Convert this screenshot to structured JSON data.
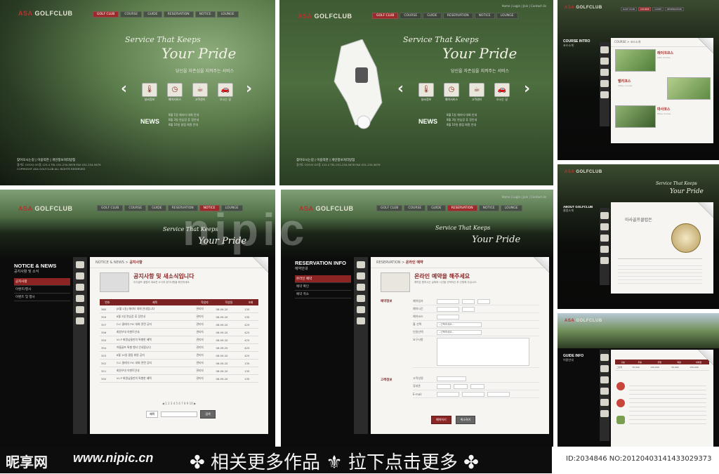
{
  "brand": {
    "logo_prefix": "ASA",
    "logo_main": "GOLFCLUB"
  },
  "nav": [
    "GOLF CLUB",
    "COURSE",
    "GUIDE",
    "RESERVATION",
    "NOTICE",
    "LOUNGE"
  ],
  "top_links": "Home | Login | Join | Contact Us",
  "slogan": {
    "line1": "Service That Keeps",
    "line2": "Your Pride",
    "line3": "당신을 자존심을 지켜주는 서비스"
  },
  "services": [
    {
      "label": "날씨정보",
      "icon": "thermometer-icon"
    },
    {
      "label": "예약서비스",
      "icon": "clock-icon"
    },
    {
      "label": "고객센터",
      "icon": "cup-icon"
    },
    {
      "label": "오시는 길",
      "icon": "car-icon"
    }
  ],
  "news": {
    "title": "NEWS",
    "items": [
      "8월 1일 채리티 대회 안내",
      "8월 3일 연습장 휴 장안내",
      "8월 10일 클럽 회원 안내"
    ]
  },
  "footer": {
    "links": "찾아오시는길 | 이용약관 | 개인정보처리방침",
    "address": "경기도 OOO시 OO동 123-4 TEL 031-234-5678 FAX 031-234-5679",
    "copyright": "COPYRIGHT ASA GOLFCLUB ALL RIGHTS RESERVED"
  },
  "course_intro": {
    "side_title": "COURSE INTRO",
    "side_sub": "코스소개",
    "crumb": "COURSE > 코스소개",
    "items": [
      {
        "name": "레이크코스",
        "text": "Lake Course"
      },
      {
        "name": "밸리코스",
        "text": "Valley Course"
      },
      {
        "name": "마사코스",
        "text": "Masa Course"
      }
    ]
  },
  "about": {
    "side_title": "ABOUT GOLFCLUB",
    "side_sub": "클럽소개",
    "heading": "아사골프클럽은"
  },
  "notice": {
    "side_title": "NOTICE & NEWS",
    "side_sub": "공지사항 및 소식",
    "menu": [
      "공지사항",
      "이벤트/행사",
      "이벤트 및 행사"
    ],
    "crumb_section": "NOTICE & NEWS",
    "crumb_page": "공지사항",
    "heading": "공지사항 및 새소식입니다",
    "desc": "아사골프 클럽의 새로운 소식과 공지사항을 확인하세요.",
    "columns": [
      "번호",
      "제목",
      "작성자",
      "작성일",
      "조회"
    ],
    "rows": [
      [
        "360",
        "[8월 1일] 채리티 대회 안내입니다",
        "관리자",
        "08.09.20",
        "135"
      ],
      [
        "359",
        "8월 3일 연습장 휴 장안내",
        "관리자",
        "08.09.20",
        "135"
      ],
      [
        "357",
        "O.C 클래식 PIC 대회 관련 공지",
        "관리자",
        "08.09.20",
        "425"
      ],
      [
        "356",
        "회원우대 이벤트안내",
        "관리자",
        "08.09.20",
        "425"
      ],
      [
        "355",
        "V.I.P 회원님들만의 특별한 혜택",
        "관리자",
        "08.09.20",
        "425"
      ],
      [
        "354",
        "여름골프 특별 행사 안내합니다",
        "관리자",
        "08.09.20",
        "425"
      ],
      [
        "353",
        "8월 10일 클럽 회원 공지",
        "관리자",
        "08.09.20",
        "425"
      ],
      [
        "352",
        "O.C 클래식 PIC 대회 관련 공지",
        "관리자",
        "08.09.20",
        "135"
      ],
      [
        "351",
        "회원우대 이벤트안내",
        "관리자",
        "08.09.20",
        "135"
      ],
      [
        "350",
        "V.I.P 회원님들만의 특별한 혜택",
        "관리자",
        "08.09.20",
        "135"
      ]
    ],
    "pager": "◀ 1 2 3 4 5 6 7 8 9 10 ▶",
    "search_select": "제목",
    "search_button": "검색"
  },
  "reservation": {
    "side_title": "RESERVATION INFO",
    "side_sub": "예약안내",
    "menu": [
      "온라인 예약",
      "예약 확인",
      "예약 취소"
    ],
    "crumb_section": "RESERVATION",
    "crumb_page": "온라인 예약",
    "heading": "온라인 예약을 해주세요",
    "desc": "예약은 원하시는 날짜와 시간을 선택하신 후 신청해 주십시오.",
    "section1": "예약정보",
    "section2": "고객정보",
    "fields1": [
      "예약일자",
      "예약시간",
      "예약코스",
      "홀 선택",
      "인원선택",
      "요구사항"
    ],
    "select_placeholder": "--선택하세요--",
    "fields2": [
      "고객성명",
      "휴대폰",
      "E-mail"
    ],
    "submit": "예약하기",
    "cancel": "취소하기"
  },
  "guide": {
    "side_title": "GUIDE INFO",
    "side_sub": "이용안내",
    "table_head": [
      "구분",
      "주중",
      "주말",
      "회원",
      "비회원"
    ],
    "table_row": [
      "그린피",
      "70,000",
      "120,000",
      "30,000",
      "150,000"
    ]
  },
  "watermark": "nipic",
  "bottom": {
    "site_logo": "昵享网",
    "site_url": "www.nipic.cn",
    "more_text": "✤ 相关更多作品 ⚜ 拉下点击更多 ✤",
    "image_id": "ID:2034846 NO:20120403141433029373"
  }
}
